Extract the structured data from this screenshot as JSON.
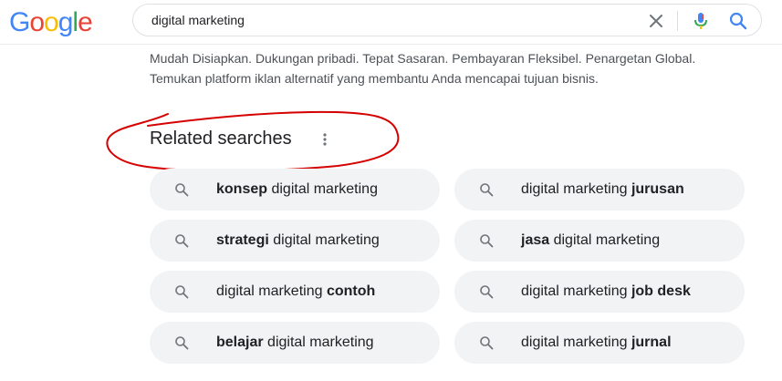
{
  "logo": {
    "text": "Google",
    "letters": [
      {
        "ch": "G",
        "color": "#4285F4"
      },
      {
        "ch": "o",
        "color": "#EA4335"
      },
      {
        "ch": "o",
        "color": "#FBBC05"
      },
      {
        "ch": "g",
        "color": "#4285F4"
      },
      {
        "ch": "l",
        "color": "#34A853"
      },
      {
        "ch": "e",
        "color": "#EA4335"
      }
    ]
  },
  "search": {
    "query": "digital marketing",
    "icons": [
      "close-icon",
      "mic-icon",
      "search-icon"
    ],
    "accent": "#4285F4"
  },
  "ad": {
    "line1": "Mudah Disiapkan. Dukungan pribadi. Tepat Sasaran. Pembayaran Fleksibel. Penargetan Global.",
    "line2": "Temukan platform iklan alternatif yang membantu Anda mencapai tujuan bisnis."
  },
  "related": {
    "title": "Related searches",
    "annotation_color": "#d50000",
    "items": [
      {
        "pre": "",
        "bold": "konsep",
        "post": " digital marketing"
      },
      {
        "pre": "digital marketing ",
        "bold": "jurusan",
        "post": ""
      },
      {
        "pre": "",
        "bold": "strategi",
        "post": " digital marketing"
      },
      {
        "pre": "",
        "bold": "jasa",
        "post": " digital marketing"
      },
      {
        "pre": "digital marketing ",
        "bold": "contoh",
        "post": ""
      },
      {
        "pre": "digital marketing ",
        "bold": "job desk",
        "post": ""
      },
      {
        "pre": "",
        "bold": "belajar",
        "post": " digital marketing"
      },
      {
        "pre": "digital marketing ",
        "bold": "jurnal",
        "post": ""
      }
    ]
  }
}
